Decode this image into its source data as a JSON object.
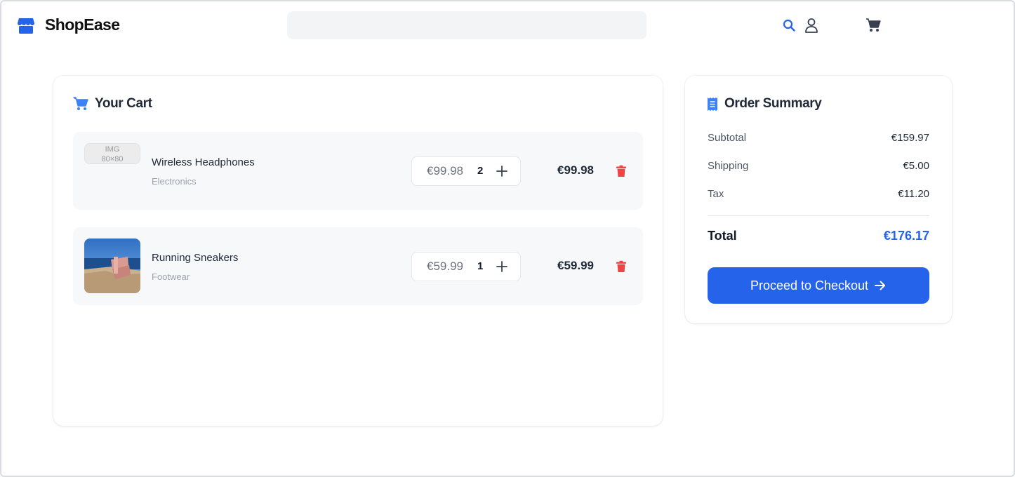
{
  "brand": {
    "name": "ShopEase",
    "accent": "#2563eb"
  },
  "header": {
    "search_placeholder": "",
    "icons": [
      "search-icon",
      "user-icon",
      "cart-icon"
    ]
  },
  "cart": {
    "title": "Your Cart",
    "items": [
      {
        "name": "Wireless Headphones",
        "category": "Electronics",
        "unit_price": "€99.98",
        "quantity": "2",
        "total": "€99.98",
        "image_placeholder": "IMG\n80×80"
      },
      {
        "name": "Running Sneakers",
        "category": "Footwear",
        "unit_price": "€59.99",
        "quantity": "1",
        "total": "€59.99"
      }
    ]
  },
  "summary": {
    "title": "Order Summary",
    "subtotal_label": "Subtotal",
    "subtotal_value": "€159.97",
    "shipping_label": "Shipping",
    "shipping_value": "€5.00",
    "tax_label": "Tax",
    "tax_value": "€11.20",
    "total_label": "Total",
    "total_value": "€176.17",
    "checkout_label": "Proceed to Checkout"
  }
}
